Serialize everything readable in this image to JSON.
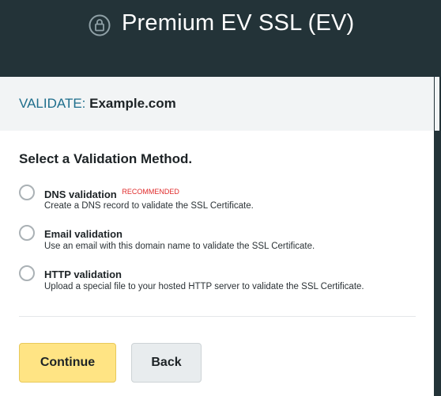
{
  "header": {
    "title": "Premium EV SSL (EV)",
    "icon": "lock-icon"
  },
  "validate": {
    "label": "VALIDATE:",
    "domain": "Example.com"
  },
  "form": {
    "heading": "Select a Validation Method.",
    "options": [
      {
        "title": "DNS validation",
        "badge": "RECOMMENDED",
        "description": "Create a DNS record to validate the SSL Certificate."
      },
      {
        "title": "Email validation",
        "description": "Use an email with this domain name to validate the SSL Certificate."
      },
      {
        "title": "HTTP validation",
        "description": "Upload a special file to your hosted HTTP server to validate the SSL Certificate."
      }
    ]
  },
  "buttons": {
    "continue_label": "Continue",
    "back_label": "Back"
  },
  "colors": {
    "header_bg": "#233338",
    "accent_label": "#1e6e8c",
    "recommended": "#e02b2b",
    "continue_bg": "#ffe484",
    "back_bg": "#e8ecee"
  }
}
